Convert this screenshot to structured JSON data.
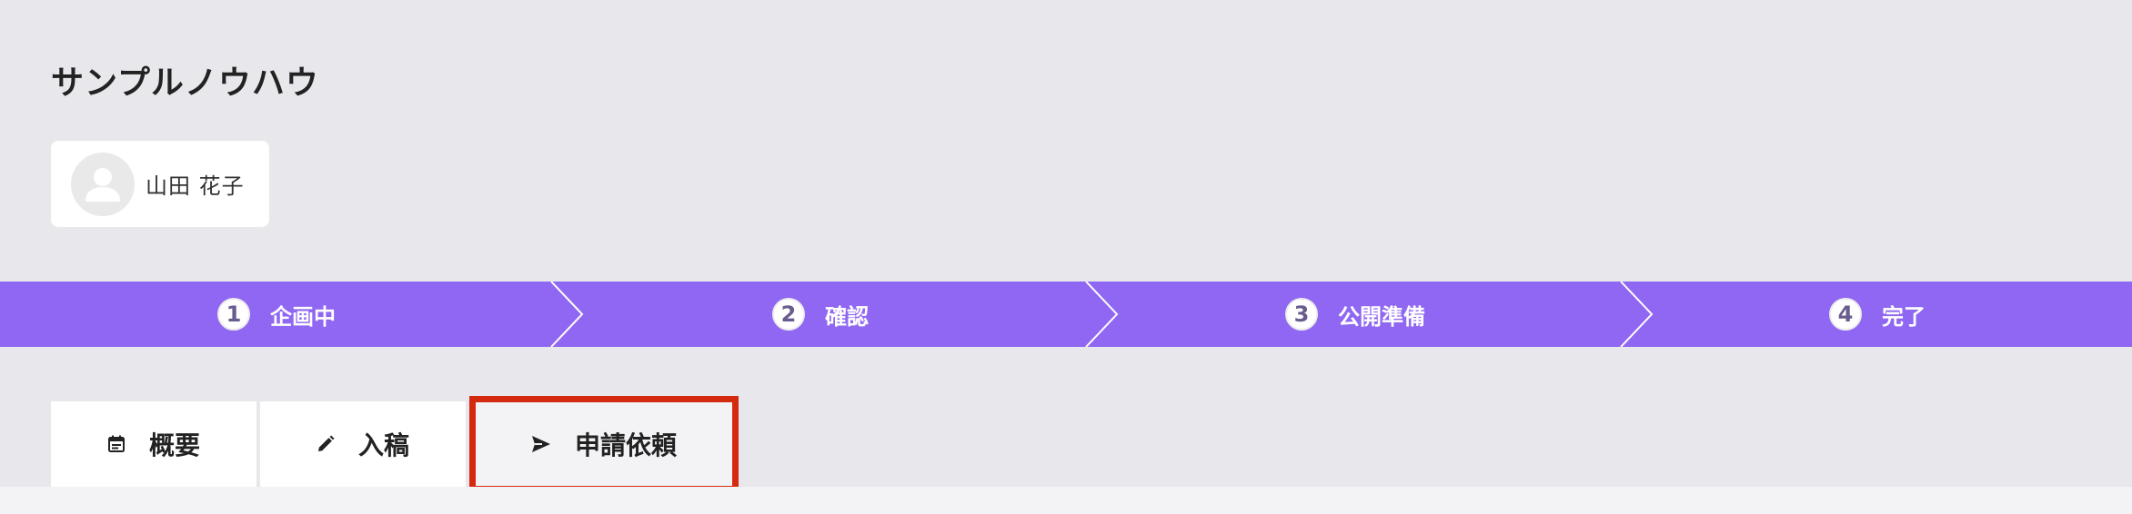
{
  "page": {
    "title": "サンプルノウハウ"
  },
  "user": {
    "name": "山田 花子",
    "avatar_icon": "person-icon"
  },
  "stepper": {
    "accent_color": "#9067f2",
    "steps": [
      {
        "number": "1",
        "label": "企画中"
      },
      {
        "number": "2",
        "label": "確認"
      },
      {
        "number": "3",
        "label": "公開準備"
      },
      {
        "number": "4",
        "label": "完了"
      }
    ]
  },
  "tabs": [
    {
      "label": "概要",
      "icon": "calendar-icon"
    },
    {
      "label": "入稿",
      "icon": "pencil-icon"
    },
    {
      "label": "申請依頼",
      "icon": "send-icon",
      "highlighted": true
    }
  ],
  "highlight_color": "#d42a10"
}
